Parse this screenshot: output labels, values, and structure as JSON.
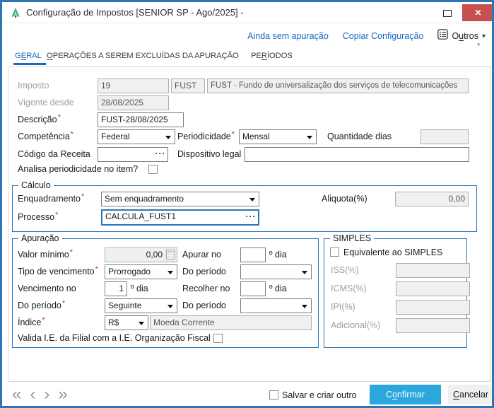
{
  "window": {
    "title": "Configuração de Impostos [SENIOR SP - Ago/2025] -"
  },
  "icons": {
    "close": "✕",
    "collapse": "▾",
    "dropdown_caret": "▾"
  },
  "toolbar": {
    "link_apuracao": "Ainda sem apuração",
    "link_copiar": "Copiar Configuração",
    "outros": {
      "pre": "O",
      "accel": "u",
      "post": "tros"
    }
  },
  "tabs": [
    {
      "pre": "G",
      "accel": "E",
      "post": "RAL"
    },
    {
      "pre": "",
      "accel": "O",
      "post": "PERAÇÕES A SEREM EXCLUÍDAS DA APURAÇÃO"
    },
    {
      "pre": "PE",
      "accel": "R",
      "post": "ÍODOS"
    }
  ],
  "geral": {
    "imposto": {
      "label": "Imposto",
      "codigo": "19",
      "sigla": "FUST",
      "nome": "FUST - Fundo de universalização dos serviços de telecomunicações"
    },
    "vigente_desde": {
      "label": "Vigente desde",
      "value": "28/08/2025"
    },
    "descricao": {
      "label": "Descrição",
      "value": "FUST-28/08/2025",
      "required": true
    },
    "competencia": {
      "label": "Competência",
      "value": "Federal",
      "required": true
    },
    "periodicidade": {
      "label": "Periodicidade",
      "value": "Mensal",
      "required": true
    },
    "quantidade_dias": {
      "label": "Quantidade dias",
      "value": ""
    },
    "codigo_receita": {
      "label": "Código da Receita",
      "value": ""
    },
    "dispositivo_legal": {
      "label": "Dispositivo legal",
      "value": ""
    },
    "analisa_periodicidade": {
      "label": "Analisa periodicidade no item?",
      "checked": false
    }
  },
  "calculo": {
    "title": "Cálculo",
    "enquadramento": {
      "label": "Enquadramento",
      "value": "Sem enquadramento",
      "required": true
    },
    "aliquota": {
      "label": "Aliquota(%)",
      "value": "0,00"
    },
    "processo": {
      "label": "Processo",
      "value": "CALCULA_FUST1",
      "required": true
    }
  },
  "apuracao": {
    "title": "Apuração",
    "valor_minimo": {
      "label": "Valor mínimo",
      "value": "0,00",
      "required": true
    },
    "apurar_no": {
      "label": "Apurar no",
      "value": "",
      "suffix": "º dia"
    },
    "tipo_vencimento": {
      "label": "Tipo de vencimento",
      "value": "Prorrogado",
      "required": true
    },
    "do_periodo_apurar": {
      "label": "Do período",
      "value": ""
    },
    "vencimento_no": {
      "label": "Vencimento no",
      "value": "1",
      "suffix": "º dia"
    },
    "recolher_no": {
      "label": "Recolher no",
      "value": "",
      "suffix": "º dia"
    },
    "do_periodo_vencimento": {
      "label": "Do período",
      "value": "Seguinte",
      "required": true
    },
    "do_periodo_recolher": {
      "label": "Do período",
      "value": ""
    },
    "indice": {
      "label": "Índice",
      "value": "R$",
      "descricao": "Moeda Corrente",
      "required": true
    },
    "valida_ie": {
      "label": "Valida I.E. da Filial com a I.E. Organização Fiscal",
      "checked": false
    }
  },
  "simples": {
    "title": "SIMPLES",
    "equivalente": {
      "label": "Equivalente ao SIMPLES",
      "checked": false
    },
    "iss": {
      "label": "ISS(%)",
      "value": ""
    },
    "icms": {
      "label": "ICMS(%)",
      "value": ""
    },
    "ipi": {
      "label": "IPI(%)",
      "value": ""
    },
    "adicional": {
      "label": "Adicional(%)",
      "value": ""
    }
  },
  "footer": {
    "nav": [
      "«",
      "‹",
      "›",
      "»"
    ],
    "salvar_criar": {
      "label": "Salvar e criar outro",
      "checked": false
    },
    "confirmar": {
      "pre": "C",
      "accel": "o",
      "post": "nfirmar"
    },
    "cancelar": {
      "pre": "",
      "accel": "C",
      "post": "ancelar"
    }
  },
  "colors": {
    "accent": "#2e75b8",
    "confirm_button": "#2ba7dd",
    "close_button": "#c75050",
    "link": "#1669c1",
    "tab_active": "#1669c1",
    "group_border": "#2e75b8"
  }
}
